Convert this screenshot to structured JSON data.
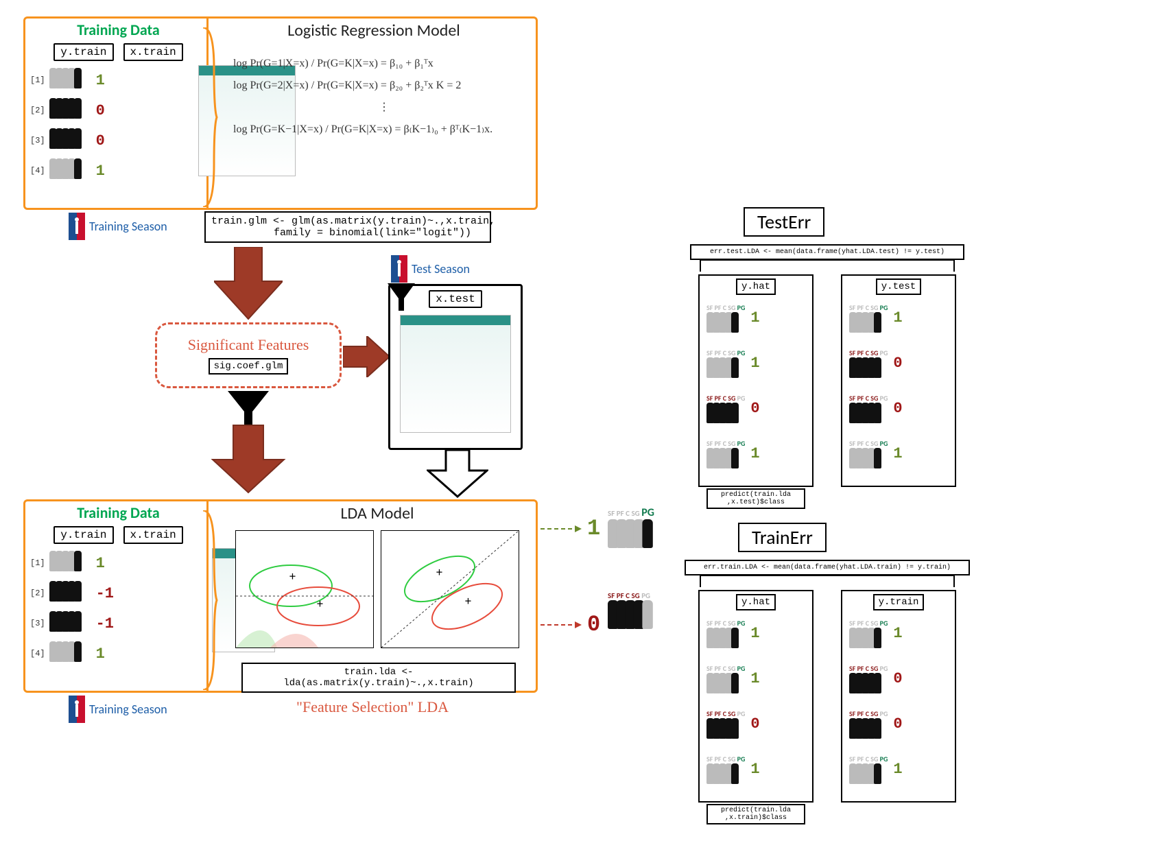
{
  "block_top": {
    "training_data_title": "Training Data",
    "y_train_label": "y.train",
    "x_train_label": "x.train",
    "rows": [
      "[1]",
      "[2]",
      "[3]",
      "[4]"
    ],
    "y_values": [
      "1",
      "0",
      "0",
      "1"
    ],
    "model_title": "Logistic Regression Model",
    "math_lines": [
      "log  Pr(G=1|X=x) / Pr(G=K|X=x)  = β₁₀ + β₁ᵀx",
      "log  Pr(G=2|X=x) / Pr(G=K|X=x)  = β₂₀ + β₂ᵀx        K = 2",
      "⋮",
      "log  Pr(G=K−1|X=x) / Pr(G=K|X=x)  = β₍K−1₎₀ + βᵀ₍K−1₎x."
    ],
    "season_label": "Training Season",
    "code": "train.glm <- glm(as.matrix(y.train)~.,x.train,\n        family = binomial(link=\"logit\"))"
  },
  "sig": {
    "title": "Significant Features",
    "code": "sig.coef.glm"
  },
  "test": {
    "season_label": "Test Season",
    "x_test_label": "x.test"
  },
  "block_bottom": {
    "training_data_title": "Training Data",
    "y_train_label": "y.train",
    "x_train_label": "x.train",
    "rows": [
      "[1]",
      "[2]",
      "[3]",
      "[4]"
    ],
    "y_values": [
      "1",
      "-1",
      "-1",
      "1"
    ],
    "model_title": "LDA Model",
    "season_label": "Training Season",
    "code": "train.lda <- lda(as.matrix(y.train)~.,x.train)",
    "fslda": "\"Feature Selection\" LDA"
  },
  "outputs": {
    "class_1": "1",
    "class_0": "0",
    "pos_pg": "PG",
    "pos_sf": "SF",
    "pos_pf": "PF",
    "pos_c": "C",
    "pos_sg": "SG"
  },
  "err_test": {
    "title": "TestErr",
    "code": "err.test.LDA <- mean(data.frame(yhat.LDA.test) != y.test)",
    "left_label": "y.hat",
    "right_label": "y.test",
    "left_vals": [
      "1",
      "1",
      "0",
      "1"
    ],
    "right_vals": [
      "1",
      "0",
      "0",
      "1"
    ],
    "predict": "predict(train.lda\n,x.test)$class"
  },
  "err_train": {
    "title": "TrainErr",
    "code": "err.train.LDA <- mean(data.frame(yhat.LDA.train) != y.train)",
    "left_label": "y.hat",
    "right_label": "y.train",
    "left_vals": [
      "1",
      "1",
      "0",
      "1"
    ],
    "right_vals": [
      "1",
      "0",
      "0",
      "1"
    ],
    "predict": "predict(train.lda\n,x.train)$class"
  }
}
